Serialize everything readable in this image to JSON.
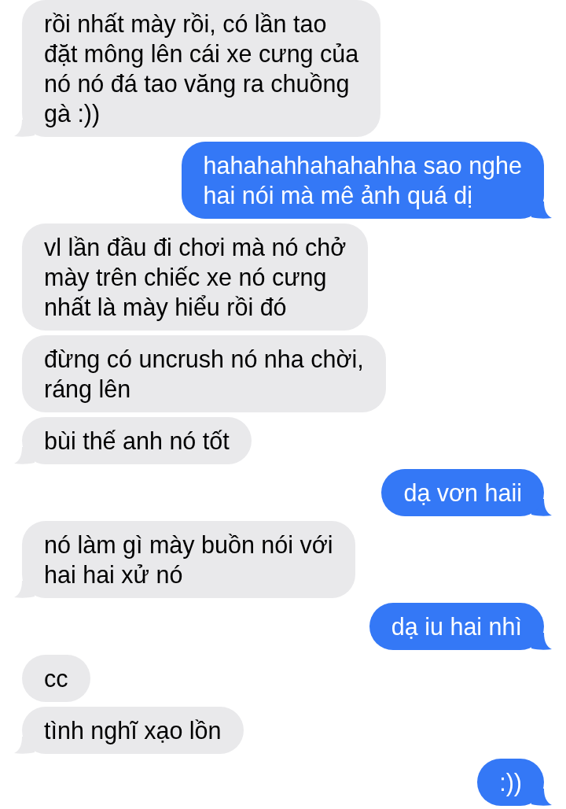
{
  "messages": [
    {
      "kind": "received",
      "text": "rồi nhất mày rồi, có lần tao\nđặt mông lên cái xe cưng của\nnó nó đá tao văng ra chuồng\ngà :))",
      "tail": true
    },
    {
      "kind": "sent",
      "text": "hahahahhahahahha sao nghe\nhai nói mà mê ảnh quá dị",
      "tail": true
    },
    {
      "kind": "received",
      "text": "vl lần đầu đi chơi mà nó chở\nmày trên chiếc xe nó cưng\nnhất là mày hiểu rồi đó",
      "tail": false
    },
    {
      "kind": "received",
      "text": "đừng có uncrush nó nha chời,\nráng lên",
      "tail": false
    },
    {
      "kind": "received",
      "text": "bùi thế anh nó tốt",
      "tail": true
    },
    {
      "kind": "sent",
      "text": "dạ vơn haii",
      "tail": true
    },
    {
      "kind": "received",
      "text": "nó làm gì mày buồn nói với\nhai hai xử nó",
      "tail": true
    },
    {
      "kind": "sent",
      "text": "dạ iu hai nhì",
      "tail": true
    },
    {
      "kind": "received",
      "text": "cc",
      "tail": false
    },
    {
      "kind": "received",
      "text": "tình nghĩ xạo lồn",
      "tail": true
    },
    {
      "kind": "sent",
      "text": ":))",
      "tail": true
    }
  ]
}
